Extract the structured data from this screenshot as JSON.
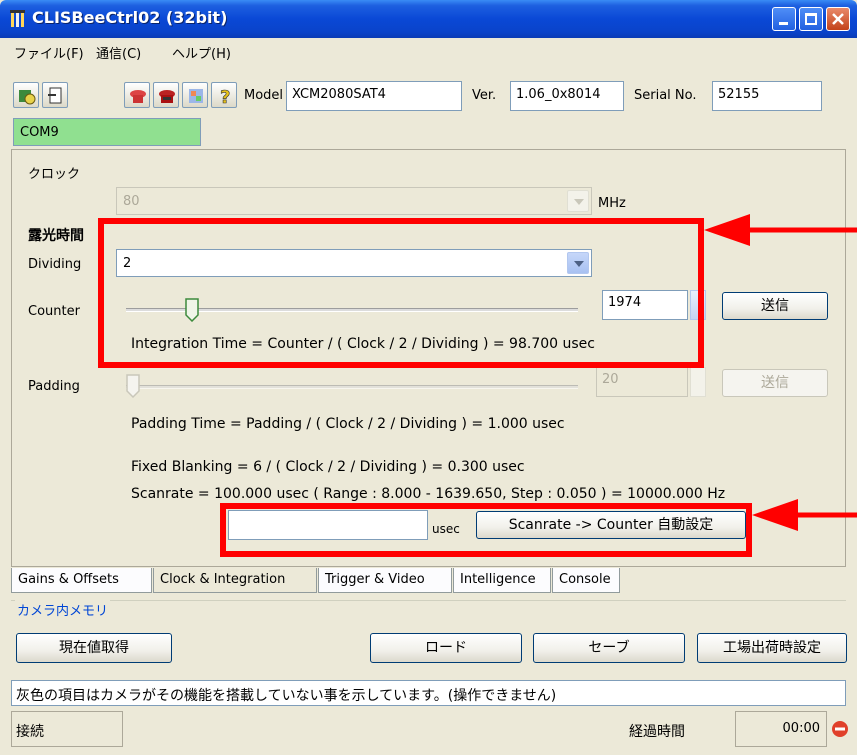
{
  "window": {
    "title": "CLISBeeCtrl02 (32bit)"
  },
  "menu": {
    "items": [
      "ファイル(F)",
      "通信(C)",
      "ヘルプ(H)"
    ]
  },
  "toolbar": {
    "model_label": "Model",
    "model_value": "XCM2080SAT4",
    "ver_label": "Ver.",
    "ver_value": "1.06_0x8014",
    "serial_label": "Serial No.",
    "serial_value": "52155"
  },
  "port": {
    "value": "COM9",
    "color": "#90e090"
  },
  "clock": {
    "label": "クロック",
    "value": "80",
    "unit": "MHz"
  },
  "exposure": {
    "label": "露光時間",
    "dividing_label": "Dividing",
    "dividing_value": "2",
    "counter_label": "Counter",
    "counter_value": "1974",
    "counter_send": "送信",
    "counter_fraction": 0.08,
    "integration_text": "Integration Time = Counter / ( Clock / 2 / Dividing ) = 98.700 usec"
  },
  "padding": {
    "label": "Padding",
    "value": "20",
    "send": "送信",
    "fraction": 0.0,
    "time_text": "Padding Time = Padding / ( Clock / 2 / Dividing ) = 1.000 usec"
  },
  "fixed_blanking_text": "Fixed Blanking = 6 / ( Clock / 2 / Dividing ) = 0.300 usec",
  "scanrate_text": "Scanrate = 100.000 usec ( Range : 8.000 - 1639.650, Step : 0.050 ) = 10000.000 Hz",
  "scanrate_input": {
    "value": "",
    "unit": "usec",
    "button": "Scanrate -> Counter 自動設定"
  },
  "tabs": [
    "Gains & Offsets",
    "Clock & Integration",
    "Trigger & Video",
    "Intelligence",
    "Console"
  ],
  "active_tab": "Clock & Integration",
  "memory": {
    "title": "カメラ内メモリ",
    "get_current": "現在値取得",
    "load": "ロード",
    "save": "セーブ",
    "factory": "工場出荷時設定"
  },
  "status_message": "灰色の項目はカメラがその機能を搭載していない事を示しています。(操作できません)",
  "statusbar": {
    "connection": "接続",
    "elapsed_label": "経過時間",
    "elapsed_value": "00:00"
  },
  "colors": {
    "highlight": "#ff0000",
    "titlebar": "#0a48d6"
  }
}
